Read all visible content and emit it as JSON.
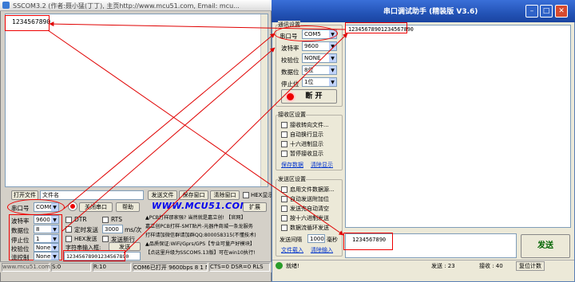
{
  "left_window": {
    "title": "SSCOM3.2 (作者:聂小猛(丁丁), 主页http://www.mcu51.com,  Email: mcu...",
    "receive_text": "1234567890",
    "toolbar": {
      "open_file": "打开文件",
      "file_name": "文件名",
      "send_file": "发送文件",
      "save_window": "保存窗口",
      "clear_window": "清除窗口",
      "hex_display": "HEX显示"
    },
    "port_row": {
      "port_label": "串口号",
      "port_value": "COM6",
      "close_port": "关闭串口",
      "help": "帮助",
      "url": "WWW.MCU51.COM",
      "expand": "扩展"
    },
    "settings": [
      {
        "label": "波特率",
        "value": "9600"
      },
      {
        "label": "数据位",
        "value": "8"
      },
      {
        "label": "停止位",
        "value": "1"
      },
      {
        "label": "校验位",
        "value": "None"
      },
      {
        "label": "流控制",
        "value": "None"
      }
    ],
    "options": {
      "dtr": "DTR",
      "rts": "RTS",
      "timed_send": "定时发送",
      "interval": "3000",
      "interval_unit": "ms/次",
      "hex_send": "HEX发送",
      "send_newline": "发送新行",
      "char_input": "字符串输入框:",
      "send_button": "发送"
    },
    "send_text": "12345678901234567890",
    "ads": [
      "▲PCB打样那家强? 当然就是嘉立创! 【官网】",
      "嘉立创PCB打样-SMT贴片-元器件商城一条龙服务",
      "打样请加微信群请加群QQ:800058315(不懂技术)",
      "▲品质保证:WiFi/Gprs/GPS【专业可量产好模块】",
      "【点这里升级为SSCOM5.13版】可在win10执行!"
    ],
    "status": {
      "site": "www.mcu51.com",
      "s": "S:0",
      "r": "R:10",
      "state": "COM6已打开  9600bps  8  1  None  None",
      "lines": "CTS=0 DSR=0 RLS"
    }
  },
  "right_window": {
    "title": "串口调试助手 (精装版 V3.6)",
    "comm_group": "通讯设置",
    "settings": [
      {
        "label": "串口号",
        "value": "COM5"
      },
      {
        "label": "波特率",
        "value": "9600"
      },
      {
        "label": "校验位",
        "value": "NONE"
      },
      {
        "label": "数据位",
        "value": "8位"
      },
      {
        "label": "停止位",
        "value": "1位"
      }
    ],
    "open_button": "断 开",
    "receive_group": "接收区设置",
    "receive_options": [
      "接收转向文件...",
      "自动换行显示",
      "十六进制显示",
      "暂停接收显示"
    ],
    "save_data": "保存数据",
    "clear_display": "清除显示",
    "send_group": "发送区设置",
    "send_options": [
      "启用文件数据源...",
      "自动发送附加位",
      "发送完自动清空",
      "按十六进制发送",
      "数据流循环发送"
    ],
    "send_interval_label": "发送间隔",
    "send_interval_value": "1000",
    "send_interval_unit": "毫秒",
    "file_load": "文件载入",
    "clear_input": "清除输入",
    "receive_text": "12345678901234567890",
    "send_text": "1234567890",
    "send_button": "发送",
    "status": {
      "ready": "就绪!",
      "sent": "发送 : 23",
      "received": "接收 : 40",
      "reset": "复位计数"
    }
  },
  "colors": {
    "annotation": "#e00000",
    "title_blue": "#2353b6",
    "url_blue": "#0000ee"
  }
}
